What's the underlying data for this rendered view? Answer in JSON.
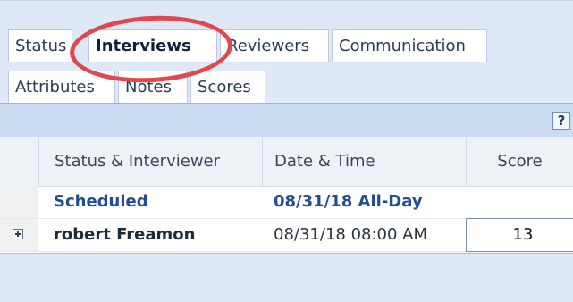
{
  "tabs_row1": [
    {
      "label": "Status"
    },
    {
      "label": "Interviews",
      "active": true
    },
    {
      "label": "Reviewers"
    },
    {
      "label": "Communication"
    }
  ],
  "tabs_row2": [
    {
      "label": "Attributes"
    },
    {
      "label": "Notes"
    },
    {
      "label": "Scores"
    }
  ],
  "toolbar": {
    "help_label": "?"
  },
  "grid": {
    "columns": [
      "Status & Interviewer",
      "Date & Time",
      "Score"
    ],
    "group": {
      "status": "Scheduled",
      "date": "08/31/18 All-Day"
    },
    "rows": [
      {
        "interviewer": "robert Freamon",
        "datetime": "08/31/18 08:00 AM",
        "score": "13"
      }
    ]
  },
  "colors": {
    "tab_bg": "#ffffff",
    "toolbar": "#cadcf2",
    "panel": "#dfe8f6",
    "group_text": "#1f4f8e",
    "highlight_circle": "#e0474f"
  }
}
